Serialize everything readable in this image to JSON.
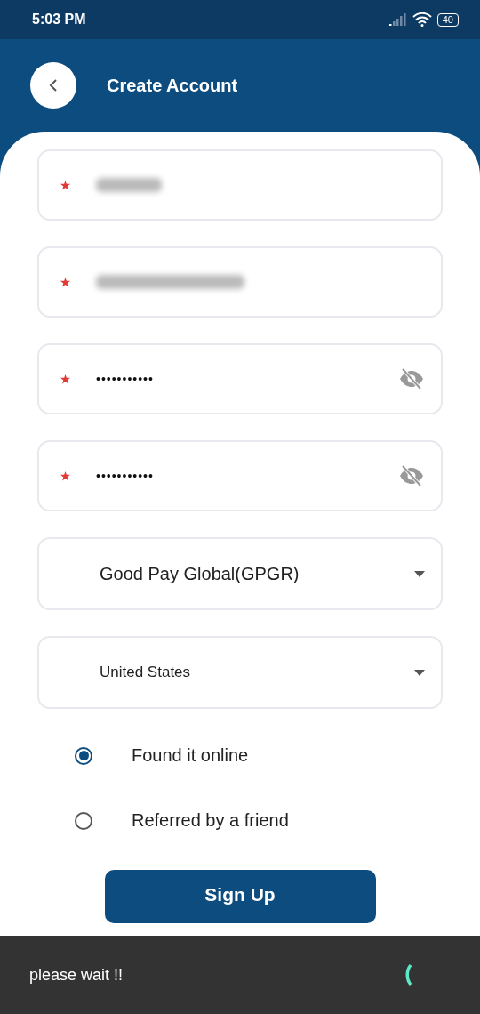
{
  "status_bar": {
    "time": "5:03 PM",
    "battery": "40"
  },
  "header": {
    "title": "Create Account"
  },
  "fields": [
    {
      "kind": "name",
      "required": true
    },
    {
      "kind": "email",
      "required": true
    },
    {
      "kind": "password",
      "required": true,
      "value": "•••••••••••"
    },
    {
      "kind": "password",
      "required": true,
      "value": "•••••••••••"
    },
    {
      "kind": "select",
      "required": false,
      "value": "Good Pay Global(GPGR)"
    },
    {
      "kind": "select",
      "required": false,
      "value": "United States"
    }
  ],
  "options": [
    {
      "label": "Found it online",
      "selected": true
    },
    {
      "label": "Referred by a friend",
      "selected": false
    }
  ],
  "submit": {
    "label": "Sign Up"
  },
  "snackbar": {
    "message": "please wait !!"
  }
}
